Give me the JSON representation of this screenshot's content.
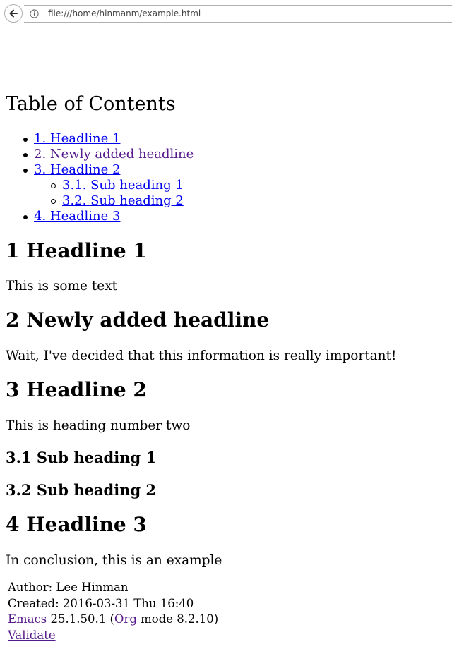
{
  "browser": {
    "url": "file:///home/hinmanm/example.html"
  },
  "toc": {
    "title": "Table of Contents",
    "items": [
      {
        "label": "1. Headline 1",
        "visited": false
      },
      {
        "label": "2. Newly added headline",
        "visited": true
      },
      {
        "label": "3. Headline 2",
        "visited": false,
        "children": [
          {
            "label": "3.1. Sub heading 1"
          },
          {
            "label": "3.2. Sub heading 2"
          }
        ]
      },
      {
        "label": "4. Headline 3",
        "visited": false
      }
    ]
  },
  "sections": {
    "s1": {
      "heading": "1 Headline 1",
      "text": "This is some text"
    },
    "s2": {
      "heading": "2 Newly added headline",
      "text": "Wait, I've decided that this information is really important!"
    },
    "s3": {
      "heading": "3 Headline 2",
      "text": "This is heading number two"
    },
    "s31": {
      "heading": "3.1 Sub heading 1"
    },
    "s32": {
      "heading": "3.2 Sub heading 2"
    },
    "s4": {
      "heading": "4 Headline 3",
      "text": "In conclusion, this is an example"
    }
  },
  "postamble": {
    "author": "Author: Lee Hinman",
    "created": "Created: 2016-03-31 Thu 16:40",
    "emacs_link": "Emacs",
    "emacs_version": " 25.1.50.1 (",
    "org_link": "Org",
    "org_version": " mode 8.2.10)",
    "validate_link": "Validate"
  },
  "colors": {
    "link": "#0000ee",
    "visited_link": "#551a8b"
  }
}
